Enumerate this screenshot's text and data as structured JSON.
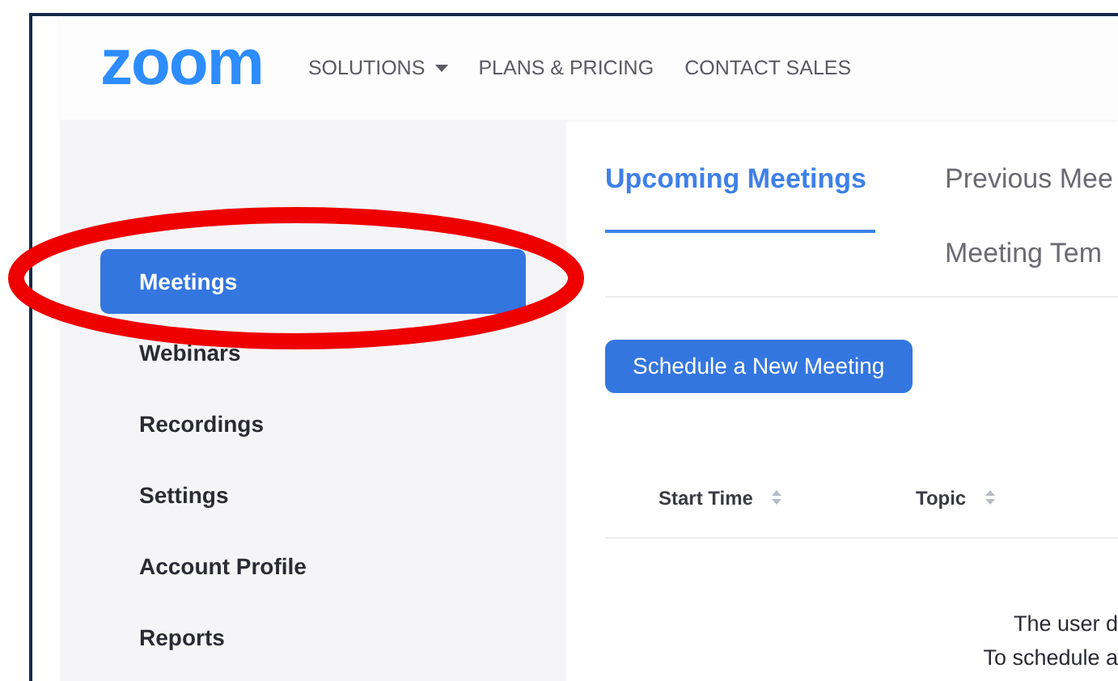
{
  "header": {
    "logo": "zoom",
    "nav": [
      {
        "label": "SOLUTIONS",
        "dropdown": true
      },
      {
        "label": "PLANS & PRICING",
        "dropdown": false
      },
      {
        "label": "CONTACT SALES",
        "dropdown": false
      }
    ]
  },
  "sidebar": {
    "items": [
      {
        "label": "Meetings",
        "selected": true
      },
      {
        "label": "Webinars",
        "selected": false
      },
      {
        "label": "Recordings",
        "selected": false
      },
      {
        "label": "Settings",
        "selected": false
      },
      {
        "label": "Account Profile",
        "selected": false
      },
      {
        "label": "Reports",
        "selected": false
      }
    ]
  },
  "tabs": [
    {
      "label": "Upcoming Meetings",
      "selected": true
    },
    {
      "label": "Previous Mee",
      "selected": false
    },
    {
      "label": "Meeting Tem",
      "selected": false
    }
  ],
  "schedule_button": "Schedule a New Meeting",
  "table": {
    "columns": [
      "Start Time",
      "Topic"
    ],
    "empty_message": [
      "The user d",
      "To schedule a"
    ]
  }
}
